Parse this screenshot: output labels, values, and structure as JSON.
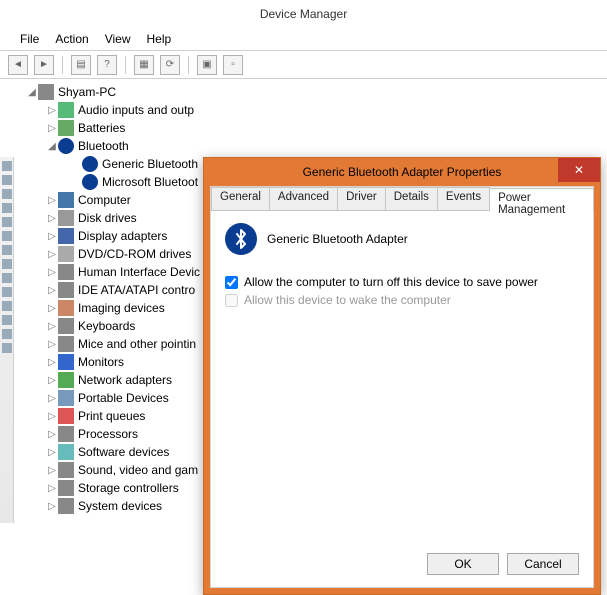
{
  "window": {
    "title": "Device Manager"
  },
  "menu": {
    "file": "File",
    "action": "Action",
    "view": "View",
    "help": "Help"
  },
  "tree": {
    "root": "Shyam-PC",
    "audio": "Audio inputs and outp",
    "batteries": "Batteries",
    "bluetooth": "Bluetooth",
    "bt_generic": "Generic Bluetooth ",
    "bt_ms": "Microsoft Bluetoot",
    "computer": "Computer",
    "disk": "Disk drives",
    "display": "Display adapters",
    "dvd": "DVD/CD-ROM drives",
    "hid": "Human Interface Devic",
    "ide": "IDE ATA/ATAPI contro",
    "imaging": "Imaging devices",
    "keyboards": "Keyboards",
    "mice": "Mice and other pointin",
    "monitors": "Monitors",
    "network": "Network adapters",
    "portable": "Portable Devices",
    "print": "Print queues",
    "processors": "Processors",
    "software": "Software devices",
    "sound": "Sound, video and gam",
    "storage": "Storage controllers",
    "system": "System devices"
  },
  "dialog": {
    "title": "Generic Bluetooth Adapter Properties",
    "tabs": {
      "general": "General",
      "advanced": "Advanced",
      "driver": "Driver",
      "details": "Details",
      "events": "Events",
      "power": "Power Management"
    },
    "device_name": "Generic Bluetooth Adapter",
    "chk_allow_off": "Allow the computer to turn off this device to save power",
    "chk_wake": "Allow this device to wake the computer",
    "ok": "OK",
    "cancel": "Cancel"
  }
}
